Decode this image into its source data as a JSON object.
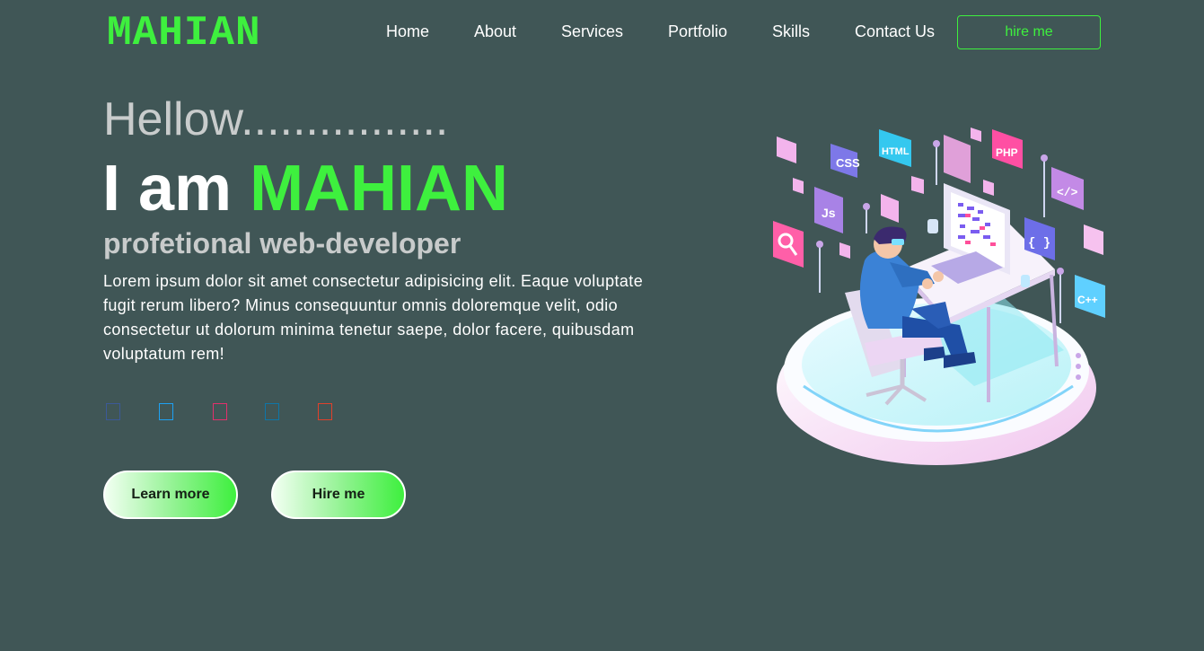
{
  "header": {
    "logo": "MAHIAN",
    "nav": [
      "Home",
      "About",
      "Services",
      "Portfolio",
      "Skills",
      "Contact Us"
    ],
    "hire_button": "hire me"
  },
  "hero": {
    "greeting": "Hellow................",
    "intro": "I am ",
    "name": "MAHIAN",
    "role": "profetional web-developer",
    "description": "Lorem ipsum dolor sit amet consectetur adipisicing elit. Eaque voluptate fugit rerum libero? Minus consequuntur omnis doloremque velit, odio consectetur ut dolorum minima tenetur saepe, dolor facere, quibusdam voluptatum rem!",
    "buttons": {
      "learn_more": "Learn more",
      "hire_me": "Hire me"
    }
  },
  "social_icons": [
    {
      "icon": "facebook-icon",
      "color": "#3b5998"
    },
    {
      "icon": "twitter-icon",
      "color": "#1da1f2"
    },
    {
      "icon": "instagram-icon",
      "color": "#e1306c"
    },
    {
      "icon": "linkedin-icon",
      "color": "#0e76a8"
    },
    {
      "icon": "youtube-icon",
      "color": "#e0412b"
    }
  ],
  "illustration": {
    "badges": [
      "CSS",
      "HTML",
      "PHP",
      "</>",
      "{ }",
      "C++",
      "Js"
    ]
  },
  "colors": {
    "background": "#405656",
    "accent": "#3ef03e",
    "text": "#ffffff",
    "muted_text": "#c9cccc"
  }
}
